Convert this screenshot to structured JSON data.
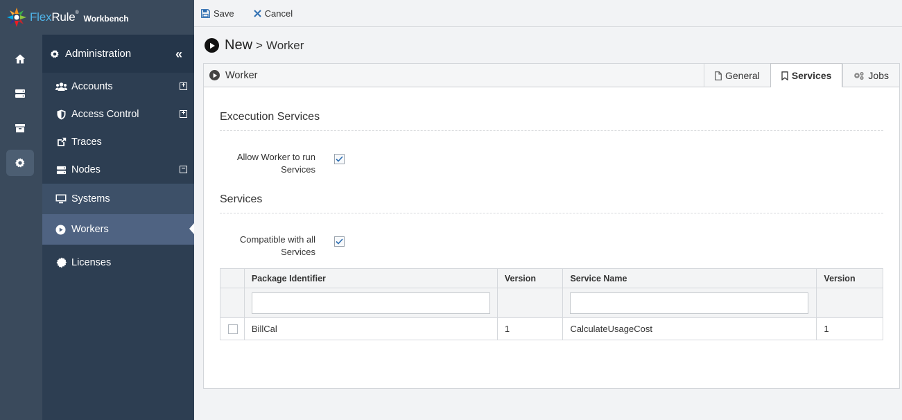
{
  "brand": {
    "name_part1": "Flex",
    "name_part2": "Rule",
    "reg_mark": "®",
    "subtitle": "Workbench"
  },
  "rail": {
    "items": [
      "home-icon",
      "server-icon",
      "archive-icon",
      "gear-icon"
    ],
    "active": "gear-icon"
  },
  "sidebar": {
    "header": "Administration",
    "collapse_glyph": "«",
    "items": [
      {
        "label": "Accounts",
        "icon": "users-icon",
        "expander": "+"
      },
      {
        "label": "Access Control",
        "icon": "shield-icon",
        "expander": "+"
      },
      {
        "label": "Traces",
        "icon": "external-link-icon",
        "expander": ""
      },
      {
        "label": "Nodes",
        "icon": "server-icon",
        "expander": "−"
      }
    ],
    "subitems": [
      {
        "label": "Systems",
        "icon": "monitor-icon",
        "selected": false
      },
      {
        "label": "Workers",
        "icon": "play-circle-icon",
        "selected": true
      }
    ],
    "footer_item": {
      "label": "Licenses",
      "icon": "certificate-icon"
    }
  },
  "toolbar": {
    "save_label": "Save",
    "cancel_label": "Cancel"
  },
  "page": {
    "title_new": "New",
    "separator": ">",
    "title_entity": "Worker"
  },
  "panel": {
    "title": "Worker",
    "tabs": [
      {
        "label": "General",
        "icon": "file-icon",
        "active": false
      },
      {
        "label": "Services",
        "icon": "bookmark-icon",
        "active": true
      },
      {
        "label": "Jobs",
        "icon": "cogs-icon",
        "active": false
      }
    ]
  },
  "execution_services": {
    "section_title": "Excecution Services",
    "allow_label_line1": "Allow Worker to run",
    "allow_label_line2": "Services",
    "allow_checked": true
  },
  "services": {
    "section_title": "Services",
    "compatible_label_line1": "Compatible with all",
    "compatible_label_line2": "Services",
    "compatible_checked": true
  },
  "grid": {
    "columns": [
      "",
      "Package Identifier",
      "Version",
      "Service Name",
      "Version"
    ],
    "filter_package_value": "",
    "filter_service_value": "",
    "rows": [
      {
        "package": "BillCal",
        "version": "1",
        "service": "CalculateUsageCost",
        "service_version": "1"
      }
    ]
  },
  "colors": {
    "rail": "#3a4a5c",
    "sidebar": "#2d3e52",
    "selected": "#4f6382",
    "brand_accent": "#4fb3e8"
  }
}
